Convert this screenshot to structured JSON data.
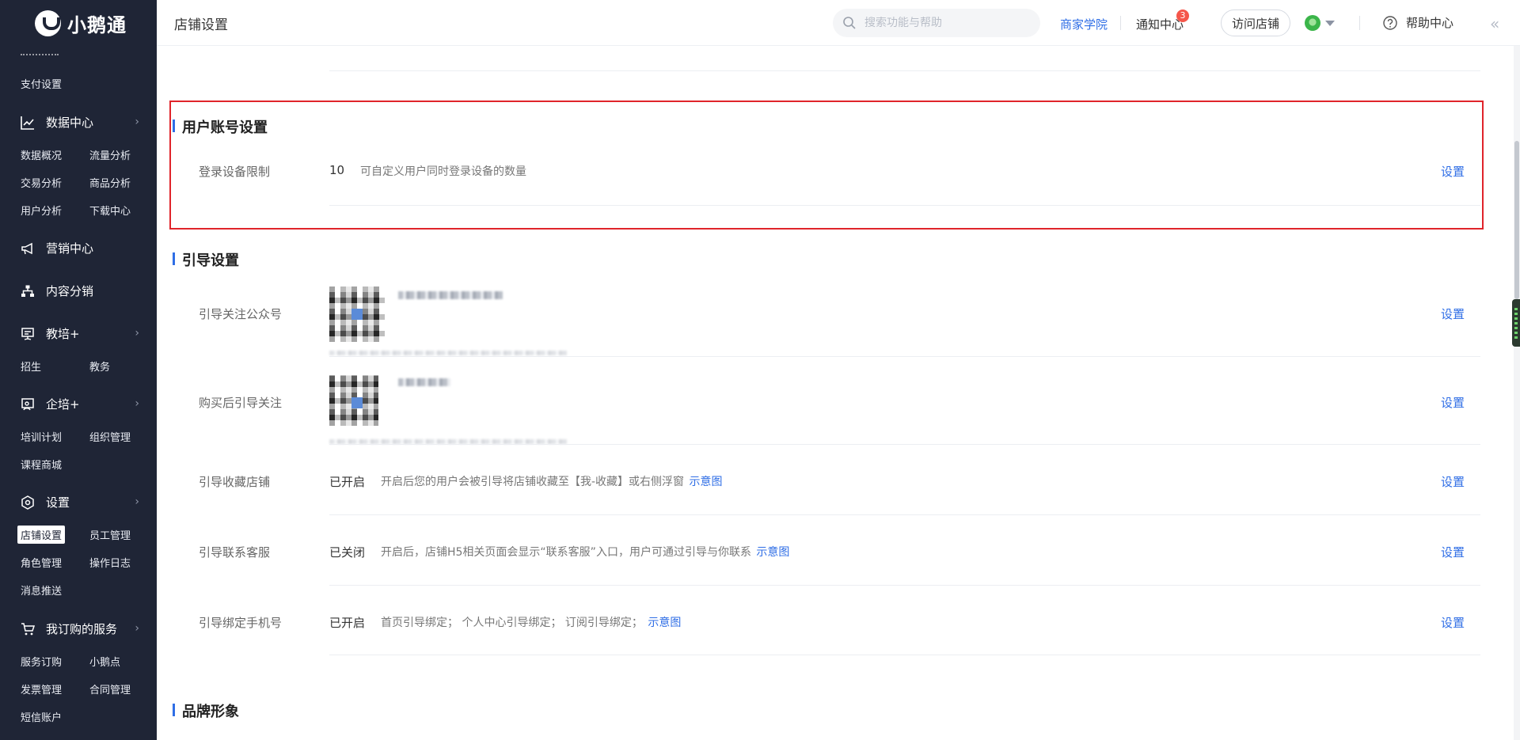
{
  "brand": {
    "name": "小鹅通"
  },
  "sidebar": {
    "items": [
      {
        "type": "sub",
        "label": "支付设置"
      },
      {
        "type": "head",
        "label": "数据中心",
        "icon": "chart-line-icon",
        "expandable": true
      },
      {
        "type": "sub",
        "label": "数据概况"
      },
      {
        "type": "sub",
        "label": "流量分析"
      },
      {
        "type": "sub",
        "label": "交易分析"
      },
      {
        "type": "sub",
        "label": "商品分析"
      },
      {
        "type": "sub",
        "label": "用户分析"
      },
      {
        "type": "sub",
        "label": "下载中心"
      },
      {
        "type": "head",
        "label": "营销中心",
        "icon": "megaphone-icon",
        "expandable": false
      },
      {
        "type": "head",
        "label": "内容分销",
        "icon": "org-tree-icon",
        "expandable": false
      },
      {
        "type": "head",
        "label": "教培+",
        "icon": "presentation-icon",
        "expandable": true
      },
      {
        "type": "sub",
        "label": "招生"
      },
      {
        "type": "sub",
        "label": "教务"
      },
      {
        "type": "head",
        "label": "企培+",
        "icon": "user-board-icon",
        "expandable": true
      },
      {
        "type": "sub",
        "label": "培训计划"
      },
      {
        "type": "sub",
        "label": "组织管理"
      },
      {
        "type": "sub",
        "label": "课程商城"
      },
      {
        "type": "head",
        "label": "设置",
        "icon": "hexagon-gear-icon",
        "expandable": true
      },
      {
        "type": "sub",
        "label": "店铺设置",
        "active": true
      },
      {
        "type": "sub",
        "label": "员工管理"
      },
      {
        "type": "sub",
        "label": "角色管理"
      },
      {
        "type": "sub",
        "label": "操作日志"
      },
      {
        "type": "sub",
        "label": "消息推送"
      },
      {
        "type": "head",
        "label": "我订购的服务",
        "icon": "cart-icon",
        "expandable": true
      },
      {
        "type": "sub",
        "label": "服务订购"
      },
      {
        "type": "sub",
        "label": "小鹅点"
      },
      {
        "type": "sub",
        "label": "发票管理"
      },
      {
        "type": "sub",
        "label": "合同管理"
      },
      {
        "type": "sub",
        "label": "短信账户"
      }
    ]
  },
  "header": {
    "title": "店铺设置",
    "search_placeholder": "搜索功能与帮助",
    "academy": "商家学院",
    "notify": "通知中心",
    "notify_count": "3",
    "visit": "访问店铺",
    "help": "帮助中心",
    "collapse_glyph": "«"
  },
  "sections": {
    "account": {
      "title": "用户账号设置",
      "rows": [
        {
          "label": "登录设备限制",
          "value": "10",
          "desc": "可自定义用户同时登录设备的数量",
          "action": "设置"
        }
      ]
    },
    "guide": {
      "title": "引导设置",
      "rows": [
        {
          "label": "引导关注公众号",
          "action": "设置"
        },
        {
          "label": "购买后引导关注",
          "action": "设置"
        },
        {
          "label": "引导收藏店铺",
          "value": "已开启",
          "desc": "开启后您的用户会被引导将店铺收藏至【我-收藏】或右侧浮窗",
          "demo": "示意图",
          "action": "设置"
        },
        {
          "label": "引导联系客服",
          "value": "已关闭",
          "desc": "开启后，店铺H5相关页面会显示“联系客服”入口，用户可通过引导与你联系",
          "demo": "示意图",
          "action": "设置"
        },
        {
          "label": "引导绑定手机号",
          "value": "已开启",
          "desc": "首页引导绑定；  个人中心引导绑定；  订阅引导绑定；",
          "demo": "示意图",
          "action": "设置"
        }
      ]
    },
    "brand": {
      "title": "品牌形象"
    }
  },
  "colors": {
    "sidebar_bg": "#1f2536",
    "accent": "#2f6ee6",
    "highlight_border": "#e0242a",
    "badge": "#f5564a"
  }
}
